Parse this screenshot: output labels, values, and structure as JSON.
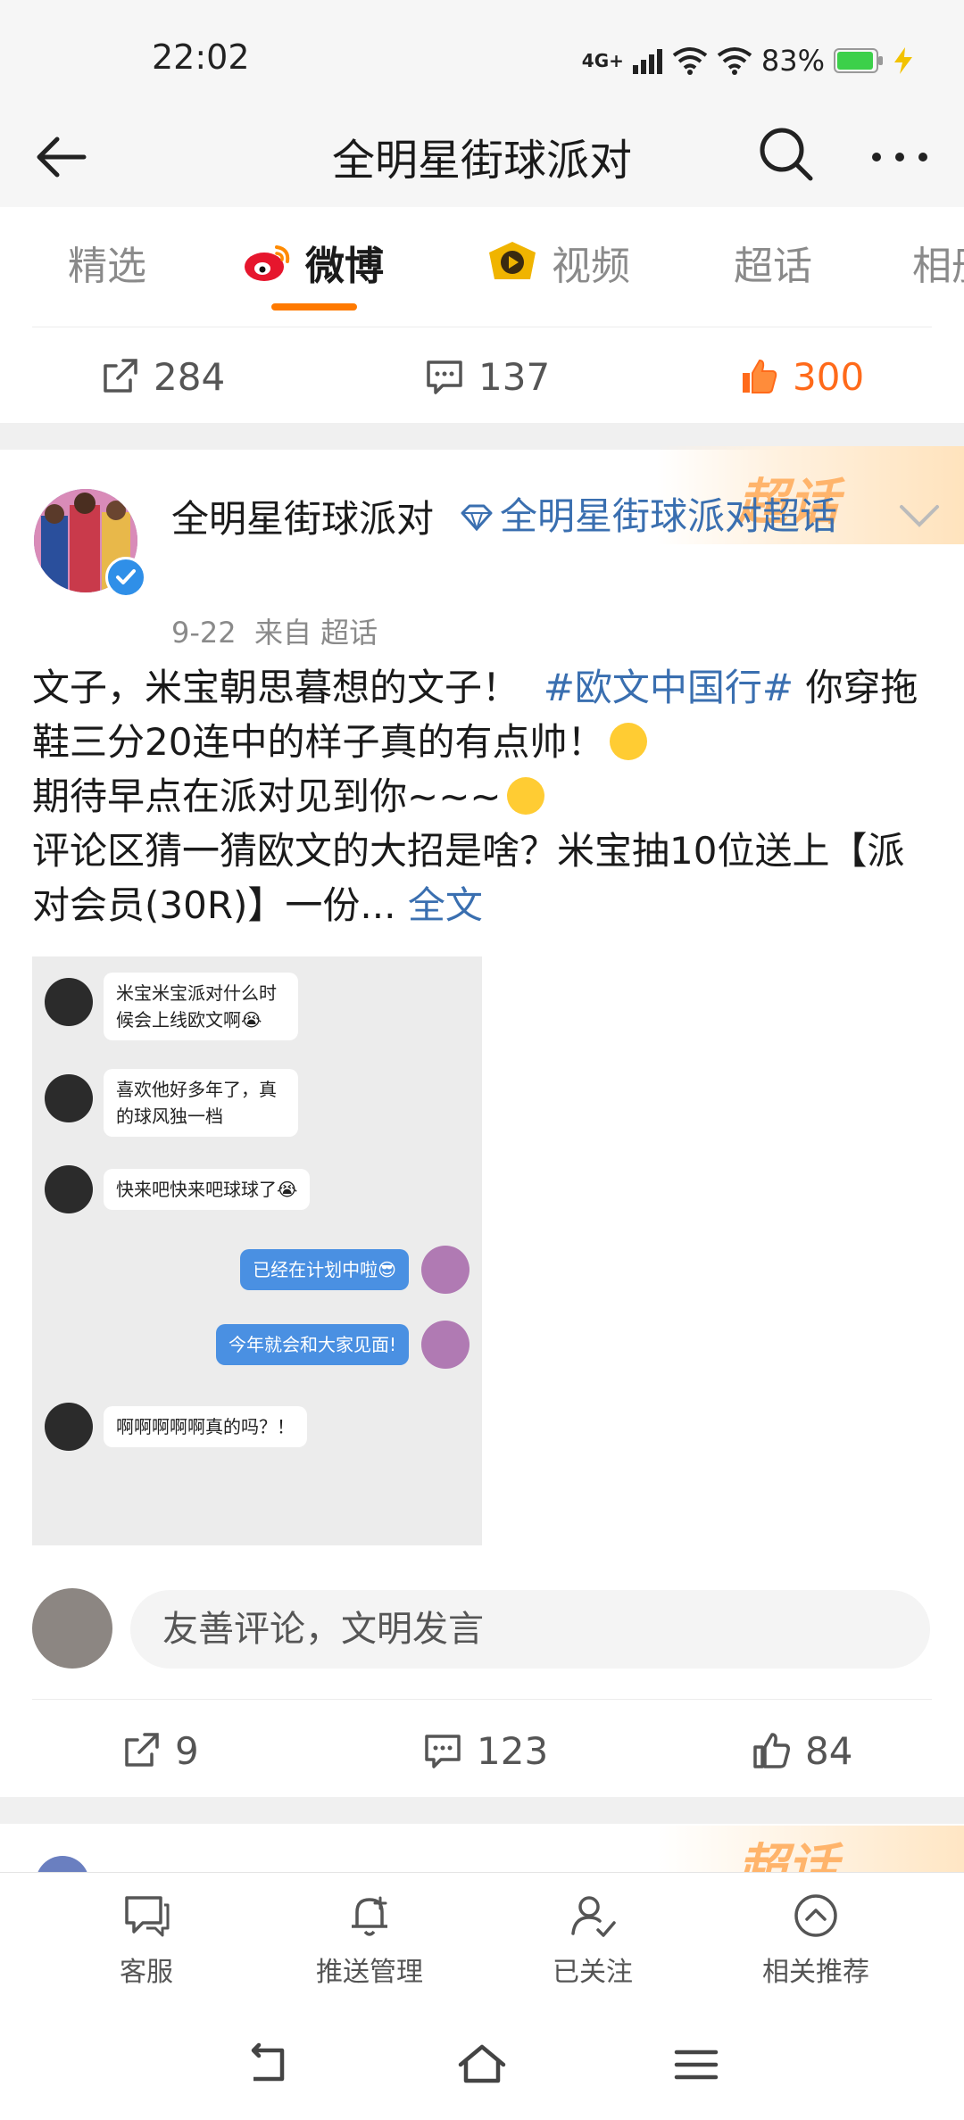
{
  "status_bar": {
    "time": "22:02",
    "network": "4G+",
    "battery": "83%"
  },
  "header": {
    "title": "全明星街球派对"
  },
  "tabs": [
    {
      "label": "精选"
    },
    {
      "label": "微博"
    },
    {
      "label": "视频"
    },
    {
      "label": "超话"
    },
    {
      "label": "相册"
    }
  ],
  "prev_post_actions": {
    "repost": "284",
    "comment": "137",
    "like": "300"
  },
  "post": {
    "chaohua_badge": "超话",
    "author": "全明星街球派对",
    "supertopic": "全明星街球派对超话",
    "date": "9-22",
    "source": "来自 超话",
    "body": {
      "line1": "文子，米宝朝思暮想的文子！",
      "hashtag": "#欧文中国行#",
      "line1b": "你穿拖鞋三分20连中的样子真的有点帅！",
      "line2": "期待早点在派对见到你~~~",
      "line3": "评论区猜一猜欧文的大招是啥？米宝抽10位送上【派对会员(30R)】一份...",
      "more": "全文"
    },
    "chat": [
      {
        "text": "米宝米宝派对什么时候会上线欧文啊😭"
      },
      {
        "text": "喜欢他好多年了，真的球风独一档"
      },
      {
        "text": "快来吧快来吧球球了😭"
      },
      {
        "text": "已经在计划中啦😎"
      },
      {
        "text": "今年就会和大家见面!"
      },
      {
        "text": "啊啊啊啊啊真的吗？！"
      }
    ],
    "comment_placeholder": "友善评论，文明发言",
    "actions": {
      "repost": "9",
      "comment": "123",
      "like": "84"
    }
  },
  "next_post": {
    "chaohua_badge": "超话"
  },
  "bottom_toolbar": [
    {
      "label": "客服",
      "icon": "chat-bubble-icon"
    },
    {
      "label": "推送管理",
      "icon": "bell-plus-icon"
    },
    {
      "label": "已关注",
      "icon": "user-check-icon"
    },
    {
      "label": "相关推荐",
      "icon": "chevron-up-circle-icon"
    }
  ],
  "colors": {
    "accent": "#ff7a00",
    "link": "#3a6fb0",
    "like": "#ff6a1a"
  }
}
